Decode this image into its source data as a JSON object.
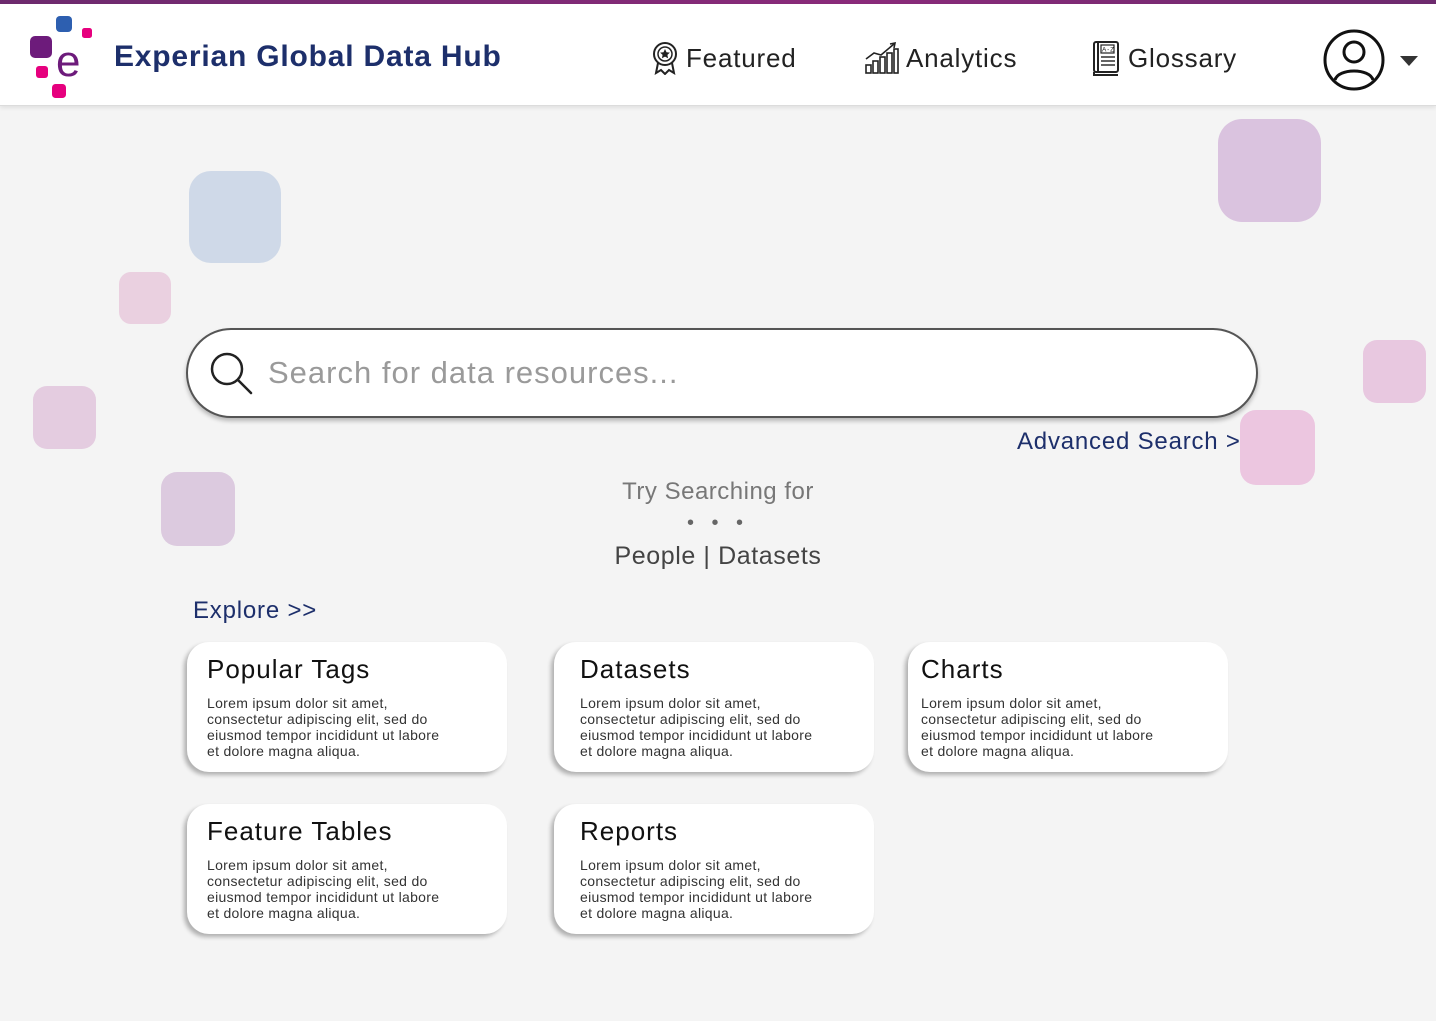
{
  "colors": {
    "brand_navy": "#1d2f6b",
    "accent_top": "#6d2a6e",
    "logo_magenta": "#e6007e",
    "logo_purple": "#6d1b7b",
    "logo_blue": "#2d5fb0"
  },
  "header": {
    "brand_name": "Experian Global Data Hub",
    "logo_icon": "experian-logo",
    "nav": [
      {
        "label": "Featured",
        "icon": "award-badge-icon"
      },
      {
        "label": "Analytics",
        "icon": "bar-chart-icon"
      },
      {
        "label": "Glossary",
        "icon": "a-z-book-icon"
      }
    ],
    "user_icon": "user-avatar-icon",
    "menu_icon": "caret-down-icon"
  },
  "search": {
    "placeholder": "Search for data resources...",
    "value": "",
    "icon": "search-icon",
    "advanced_label": "Advanced Search >"
  },
  "suggestions": {
    "heading": "Try Searching for",
    "dots": "• • •",
    "items": [
      "People",
      "Datasets"
    ],
    "separator": " | "
  },
  "explore": {
    "label": "Explore >>",
    "cards": [
      {
        "title": "Popular Tags",
        "text": "Lorem ipsum dolor sit amet, consectetur adipiscing elit, sed do eiusmod tempor incididunt ut labore et dolore magna aliqua."
      },
      {
        "title": "Datasets",
        "text": "Lorem ipsum dolor sit amet, consectetur adipiscing elit, sed do eiusmod tempor incididunt ut labore et dolore magna aliqua."
      },
      {
        "title": "Charts",
        "text": "Lorem ipsum dolor sit amet, consectetur adipiscing elit, sed do eiusmod tempor incididunt ut labore et dolore magna aliqua."
      },
      {
        "title": "Feature Tables",
        "text": "Lorem ipsum dolor sit amet, consectetur adipiscing elit, sed do eiusmod tempor incididunt ut labore et dolore magna aliqua."
      },
      {
        "title": "Reports",
        "text": "Lorem ipsum dolor sit amet, consectetur adipiscing elit, sed do eiusmod tempor incididunt ut labore et dolore magna aliqua."
      }
    ]
  }
}
